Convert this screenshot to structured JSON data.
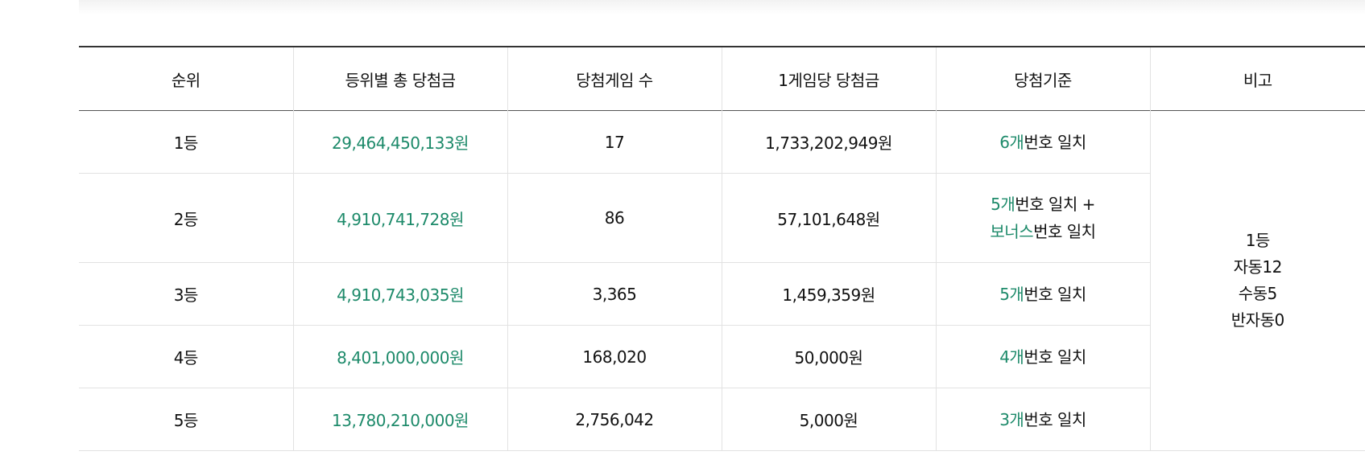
{
  "headers": [
    "순위",
    "등위별 총 당첨금",
    "당첨게임 수",
    "1게임당 당첨금",
    "당첨기준",
    "비고"
  ],
  "rows": [
    {
      "rank": "1등",
      "total": "29,464,450,133원",
      "games": "17",
      "per_game": "1,733,202,949원",
      "criteria_hl": "6개",
      "criteria_text": "번호 일치"
    },
    {
      "rank": "2등",
      "total": "4,910,741,728원",
      "games": "86",
      "per_game": "57,101,648원",
      "criteria_hl": "5개",
      "criteria_text": "번호 일치 +",
      "criteria_hl2": "보너스",
      "criteria_text2": "번호 일치"
    },
    {
      "rank": "3등",
      "total": "4,910,743,035원",
      "games": "3,365",
      "per_game": "1,459,359원",
      "criteria_hl": "5개",
      "criteria_text": "번호 일치"
    },
    {
      "rank": "4등",
      "total": "8,401,000,000원",
      "games": "168,020",
      "per_game": "50,000원",
      "criteria_hl": "4개",
      "criteria_text": "번호 일치"
    },
    {
      "rank": "5등",
      "total": "13,780,210,000원",
      "games": "2,756,042",
      "per_game": "5,000원",
      "criteria_hl": "3개",
      "criteria_text": "번호 일치"
    }
  ],
  "remark": {
    "line1": "1등",
    "line2": "자동12",
    "line3": "수동5",
    "line4": "반자동0"
  },
  "colors": {
    "highlight": "#1d8a6a",
    "text": "#111111",
    "border": "#e2e2e2"
  }
}
